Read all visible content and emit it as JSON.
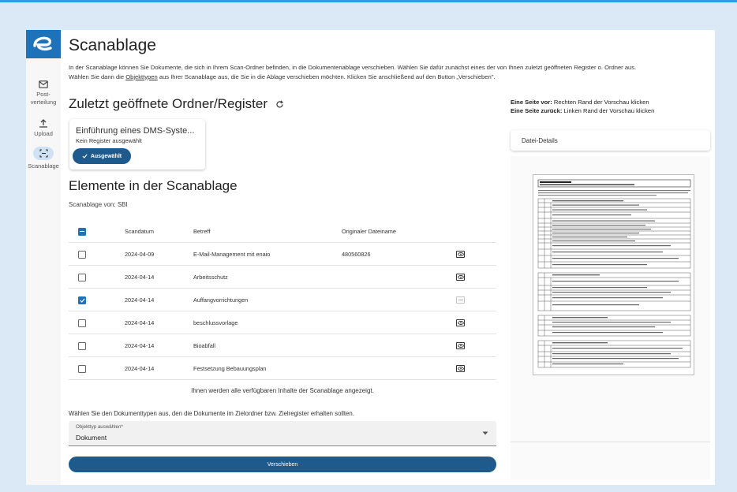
{
  "app": {
    "page_title": "Scanablage",
    "intro_1": "In der Scanablage können Sie Dokumente, die sich in Ihrem Scan-Ordner befinden, in die Dokumentenablage verschieben. Wählen Sie dafür zunächst eines der von Ihnen zuletzt geöffneten Register o. Ordner aus.",
    "intro_2a": "Wählen Sie dann die ",
    "intro_2_link": "Objekttypen",
    "intro_2b": " aus Ihrer Scanablage aus, die Sie in die Ablage verschieben möchten. Klicken Sie anschließend auf den Button „Verschieben\"."
  },
  "rail": {
    "items": [
      {
        "label": "Post-\nverteilung",
        "icon": "mail-icon"
      },
      {
        "label": "Upload",
        "icon": "upload-icon"
      },
      {
        "label": "Scanablage",
        "icon": "scanner-icon"
      }
    ]
  },
  "recent": {
    "heading": "Zuletzt geöffnete Ordner/Register",
    "card_title": "Einführung eines DMS-Syste...",
    "card_sub": "Kein Register ausgewählt",
    "chip_label": "Ausgewählt"
  },
  "elements": {
    "heading": "Elemente in der Scanablage",
    "scan_from": "Scanablage von: SBI",
    "columns": [
      "Scandatum",
      "Betreff",
      "Originaler Dateiname"
    ],
    "rows": [
      {
        "date": "2024-04-09",
        "subject": "E-Mail-Management mit enaio",
        "file": "480560826",
        "checked": false
      },
      {
        "date": "2024-04-14",
        "subject": "Arbeitsschutz",
        "file": "",
        "checked": false
      },
      {
        "date": "2024-04-14",
        "subject": "Auffangvorrichtungen",
        "file": "",
        "checked": true
      },
      {
        "date": "2024-04-14",
        "subject": "beschlussvorlage",
        "file": "",
        "checked": false
      },
      {
        "date": "2024-04-14",
        "subject": "Bioabfall",
        "file": "",
        "checked": false
      },
      {
        "date": "2024-04-14",
        "subject": "Festsetzung Bebauungsplan",
        "file": "",
        "checked": false
      }
    ],
    "all_note": "Ihnen werden alle verfügbaren Inhalte der Scanablage angezeigt."
  },
  "type_select": {
    "prompt": "Wählen Sie den Dokumenttypen aus, den die Dokumente im Zielordner bzw. Zielregister erhalten sollten.",
    "label": "Objekttyp auswählen*",
    "value": "Dokument"
  },
  "move_button": "Verschieben",
  "hints": {
    "next_bold": "Eine Seite vor:",
    "next_text": " Rechten Rand der Vorschau klicken",
    "prev_bold": "Eine Seite zurück:",
    "prev_text": " Linken Rand der Vorschau klicken"
  },
  "details_label": "Datei-Details",
  "colors": {
    "accent": "#1e73b8",
    "button": "#1e5a8c",
    "outer_bg": "#dbe9f7",
    "top_border": "#2a9fe0"
  }
}
